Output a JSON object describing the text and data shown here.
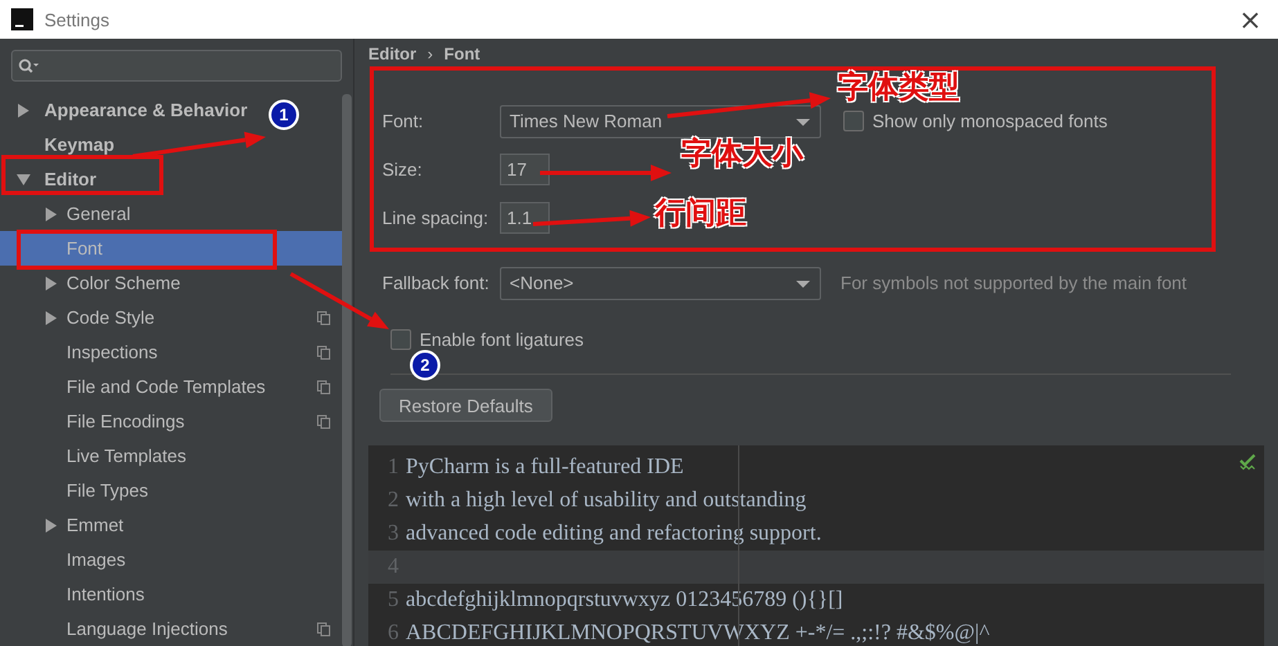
{
  "window": {
    "title": "Settings",
    "close": "×"
  },
  "sidebar": {
    "items": [
      {
        "label": "Appearance & Behavior",
        "selected": false,
        "expanded": false
      },
      {
        "label": "Keymap",
        "selected": false
      },
      {
        "label": "Editor",
        "selected": false,
        "expanded": true,
        "children": [
          {
            "label": "General",
            "selected": false,
            "expanded": false,
            "project_level": false
          },
          {
            "label": "Font",
            "selected": true,
            "project_level": false
          },
          {
            "label": "Color Scheme",
            "selected": false,
            "expanded": false,
            "project_level": false
          },
          {
            "label": "Code Style",
            "selected": false,
            "expanded": false,
            "project_level": true
          },
          {
            "label": "Inspections",
            "selected": false,
            "project_level": true
          },
          {
            "label": "File and Code Templates",
            "selected": false,
            "project_level": true
          },
          {
            "label": "File Encodings",
            "selected": false,
            "project_level": true
          },
          {
            "label": "Live Templates",
            "selected": false,
            "project_level": false
          },
          {
            "label": "File Types",
            "selected": false,
            "project_level": false
          },
          {
            "label": "Emmet",
            "selected": false,
            "expanded": false,
            "project_level": false
          },
          {
            "label": "Images",
            "selected": false,
            "project_level": false
          },
          {
            "label": "Intentions",
            "selected": false,
            "project_level": false
          },
          {
            "label": "Language Injections",
            "selected": false,
            "project_level": true
          }
        ]
      }
    ]
  },
  "breadcrumb": {
    "items": [
      "Editor",
      "Font"
    ],
    "separator": "›"
  },
  "font": {
    "label": "Font:",
    "value": "Times New Roman",
    "monospaced_checkbox": {
      "label": "Show only monospaced fonts",
      "checked": false
    }
  },
  "size": {
    "label": "Size:",
    "value": "17"
  },
  "line_spacing": {
    "label": "Line spacing:",
    "value": "1.1"
  },
  "fallback": {
    "label": "Fallback font:",
    "value": "<None>",
    "hint": "For symbols not supported by the main font"
  },
  "ligatures": {
    "label": "Enable font ligatures",
    "checked": false
  },
  "restore_button": "Restore Defaults",
  "preview": {
    "lines": [
      {
        "number": "1",
        "text": "PyCharm is a full-featured IDE",
        "current": false
      },
      {
        "number": "2",
        "text": "with a high level of usability and outstanding",
        "current": false
      },
      {
        "number": "3",
        "text": "advanced code editing and refactoring support.",
        "current": false
      },
      {
        "number": "4",
        "current": true
      },
      {
        "number": "5",
        "text": "abcdefghijklmnopqrstuvwxyz 0123456789 (){}[]",
        "current": false
      },
      {
        "number": "6",
        "text": "ABCDEFGHIJKLMNOPQRSTUVWXYZ +-*/= .,;:!? #&$%@|^",
        "current": false
      }
    ]
  },
  "annotations": {
    "markers": [
      "1",
      "2"
    ],
    "callouts": [
      "字体类型",
      "字体大小",
      "行间距"
    ]
  }
}
